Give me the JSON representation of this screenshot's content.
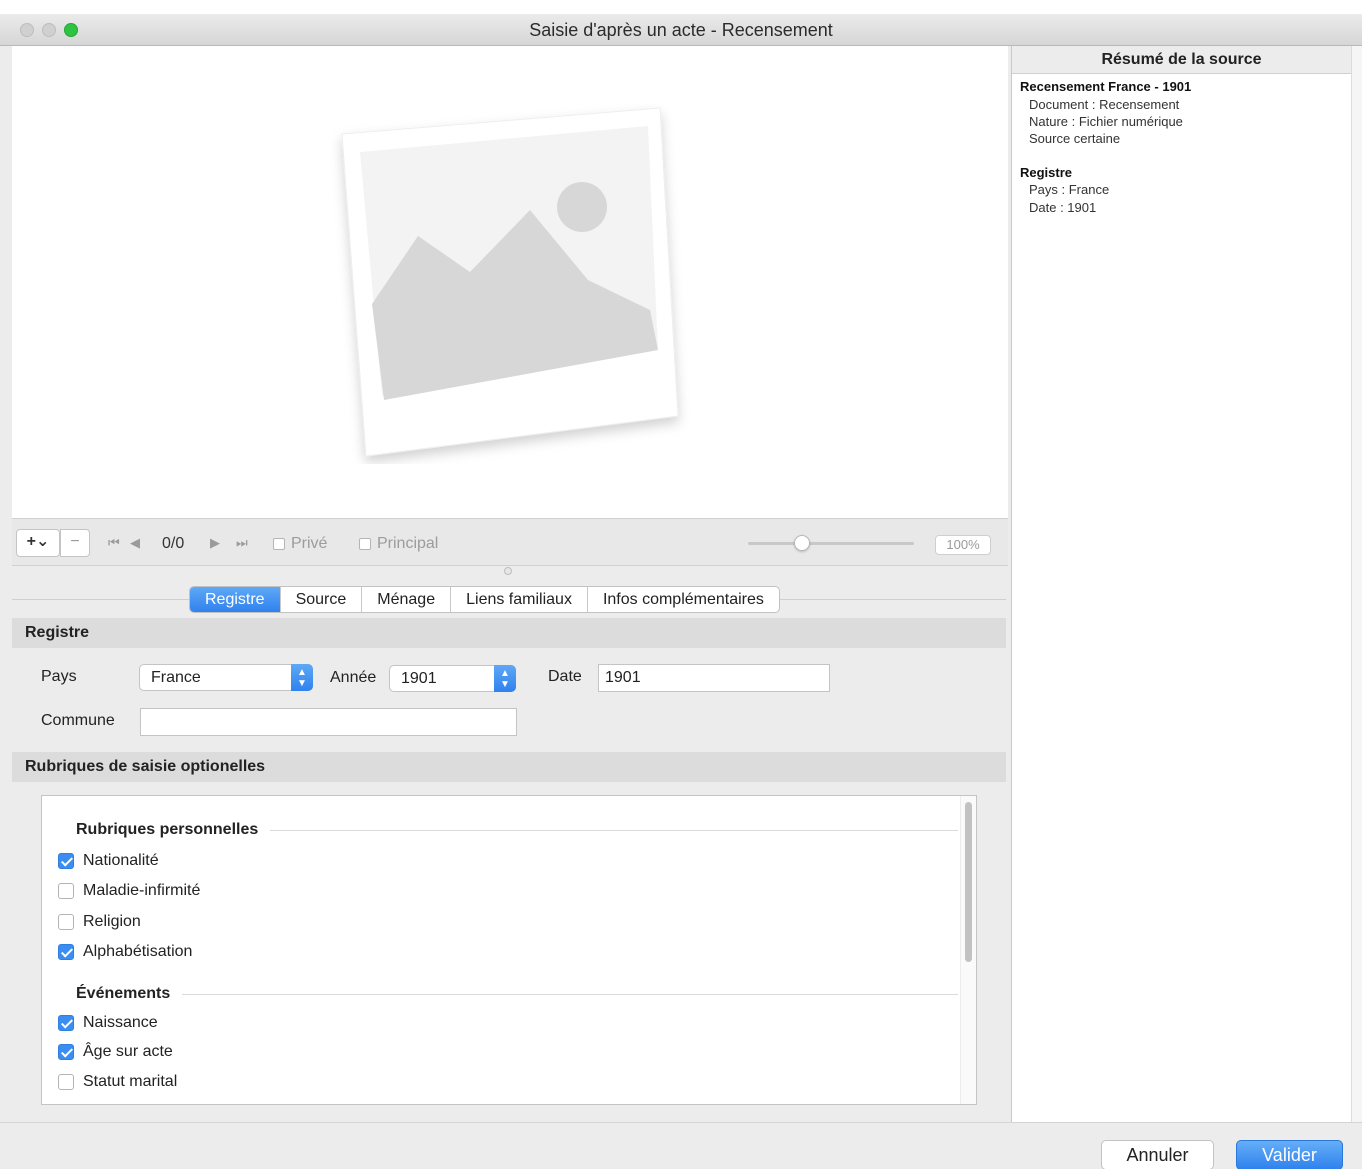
{
  "window": {
    "title": "Saisie d'après un acte - Recensement"
  },
  "media_toolbar": {
    "add_label": "+⌄",
    "remove_label": "−",
    "counter": "0/0",
    "prive_label": "Privé",
    "principal_label": "Principal",
    "zoom": "100%"
  },
  "tabs": [
    {
      "label": "Registre",
      "active": true
    },
    {
      "label": "Source",
      "active": false
    },
    {
      "label": "Ménage",
      "active": false
    },
    {
      "label": "Liens familiaux",
      "active": false
    },
    {
      "label": "Infos complémentaires",
      "active": false
    }
  ],
  "registre": {
    "header": "Registre",
    "pays_label": "Pays",
    "pays_value": "France",
    "annee_label": "Année",
    "annee_value": "1901",
    "date_label": "Date",
    "date_value": "1901",
    "commune_label": "Commune",
    "commune_value": ""
  },
  "rubriques": {
    "header": "Rubriques de saisie optionelles",
    "groups": [
      {
        "title": "Rubriques personnelles",
        "items": [
          {
            "label": "Nationalité",
            "checked": true
          },
          {
            "label": "Maladie-infirmité",
            "checked": false
          },
          {
            "label": "Religion",
            "checked": false
          },
          {
            "label": "Alphabétisation",
            "checked": true
          }
        ]
      },
      {
        "title": "Événements",
        "items": [
          {
            "label": "Naissance",
            "checked": true
          },
          {
            "label": "Âge sur acte",
            "checked": true
          },
          {
            "label": "Statut marital",
            "checked": false
          }
        ]
      }
    ]
  },
  "summary": {
    "header": "Résumé de la source",
    "blocks": [
      {
        "title": "Recensement France - 1901",
        "lines": [
          "Document : Recensement",
          "Nature : Fichier numérique",
          "Source certaine"
        ]
      },
      {
        "title": "Registre",
        "lines": [
          "Pays : France",
          "Date : 1901"
        ]
      }
    ]
  },
  "buttons": {
    "cancel": "Annuler",
    "ok": "Valider"
  },
  "colors": {
    "accent": "#2f82ee",
    "window_bg": "#ececec"
  }
}
